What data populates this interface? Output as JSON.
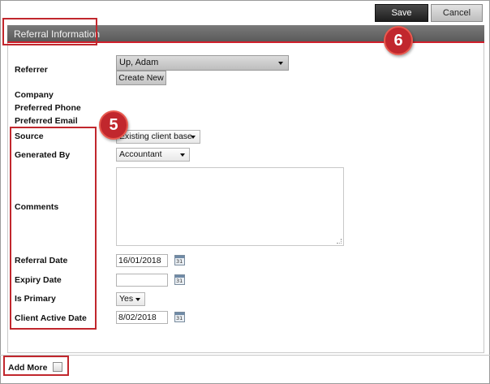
{
  "toolbar": {
    "save_label": "Save",
    "cancel_label": "Cancel"
  },
  "section": {
    "title": "Referral Information"
  },
  "form": {
    "referrer": {
      "label": "Referrer",
      "value": "Up, Adam",
      "create_new_label": "Create New"
    },
    "company": {
      "label": "Company"
    },
    "preferred_phone": {
      "label": "Preferred Phone"
    },
    "preferred_email": {
      "label": "Preferred Email"
    },
    "source": {
      "label": "Source",
      "value": "Existing client base"
    },
    "generated_by": {
      "label": "Generated By",
      "value": "Accountant"
    },
    "comments": {
      "label": "Comments",
      "value": ""
    },
    "referral_date": {
      "label": "Referral Date",
      "value": "16/01/2018"
    },
    "expiry_date": {
      "label": "Expiry Date",
      "value": ""
    },
    "is_primary": {
      "label": "Is Primary",
      "value": "Yes"
    },
    "client_active_date": {
      "label": "Client Active Date",
      "value": "8/02/2018"
    }
  },
  "add_more": {
    "label": "Add More",
    "checked": false
  },
  "annotations": {
    "badge_5": "5",
    "badge_6": "6"
  },
  "icons": {
    "calendar": "calendar-icon",
    "dropdown": "chevron-down-icon"
  },
  "colors": {
    "accent_red": "#c1272d",
    "header_gray": "#666666",
    "save_dark": "#222222"
  }
}
